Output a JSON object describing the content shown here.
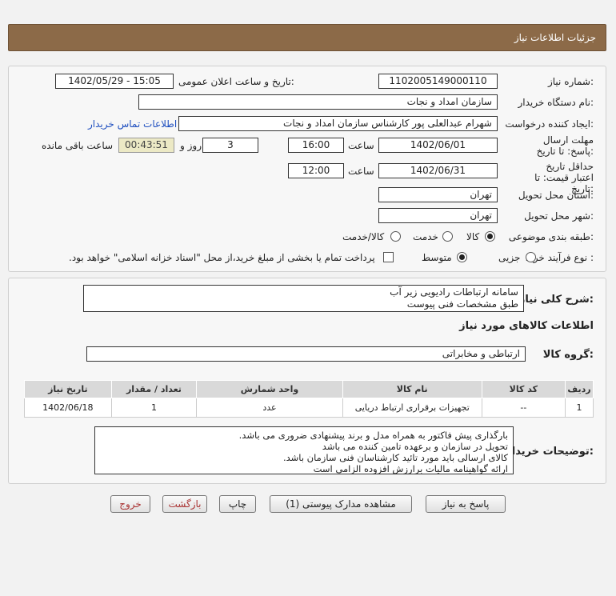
{
  "header": {
    "title": "جزئیات اطلاعات نیاز"
  },
  "form": {
    "need_number_label": "شماره نیاز:",
    "need_number": "1102005149000110",
    "announce_label": "تاریخ و ساعت اعلان عمومی:",
    "announce_value": "1402/05/29 - 15:05",
    "buyer_org_label": "نام دستگاه خریدار:",
    "buyer_org": "سازمان امداد و نجات",
    "requester_label": "ایجاد کننده درخواست:",
    "requester": "شهرام عبدالعلی پور کارشناس   سازمان امداد و نجات",
    "contact_link": "اطلاعات تماس خریدار",
    "deadline_label": "مهلت ارسال پاسخ: تا تاریخ:",
    "deadline_date": "1402/06/01",
    "time_label": "ساعت",
    "deadline_time": "16:00",
    "days_value": "3",
    "days_label": "روز و",
    "remaining_time": "00:43:51",
    "remaining_label": "ساعت باقی مانده",
    "validity_label": "حداقل تاریخ اعتبار قیمت: تا تاریخ:",
    "validity_date": "1402/06/31",
    "validity_time": "12:00",
    "province_label": "استان محل تحویل:",
    "province": "تهران",
    "city_label": "شهر محل تحویل:",
    "city": "تهران",
    "category_label": "طبقه بندی موضوعی:",
    "category_options": [
      "کالا",
      "خدمت",
      "کالا/خدمت"
    ],
    "category_selected": "کالا",
    "process_label": "نوع فرآیند خرید :",
    "process_options": [
      "جزیی",
      "متوسط"
    ],
    "process_selected": "متوسط",
    "payment_note": "پرداخت تمام یا بخشی از مبلغ خرید،از محل \"اسناد خزانه اسلامی\" خواهد بود."
  },
  "summary": {
    "label": "شرح کلی نیاز:",
    "line1": "سامانه ارتباطات رادیویی زیر آب",
    "line2": "طبق مشخصات فنی پیوست"
  },
  "goods": {
    "section_title": "اطلاعات کالاهای مورد نیاز",
    "group_label": "گروه کالا:",
    "group_value": "ارتباطی و مخابراتی",
    "columns": [
      "ردیف",
      "کد کالا",
      "نام کالا",
      "واحد شمارش",
      "تعداد / مقدار",
      "تاریخ نیاز"
    ],
    "rows": [
      {
        "row": "1",
        "code": "--",
        "name": "تجهیزات برقراری ارتباط دریایی",
        "unit": "عدد",
        "qty": "1",
        "date": "1402/06/18"
      }
    ]
  },
  "buyer_notes": {
    "label": "توضیحات خریدار:",
    "lines": [
      "بارگذاری پیش فاکتور به همراه مدل و برند پیشنهادی ضروری می باشد.",
      "تحویل در سازمان و برعهده تامین کننده می باشد",
      "کالای ارسالی باید مورد تائید کارشناسان فنی سازمان باشد.",
      "ارائه گواهینامه مالیات برارزش افزوده الزامی است"
    ]
  },
  "buttons": {
    "reply": "پاسخ به نیاز",
    "attachments": "مشاهده مدارک پیوستی (1)",
    "print": "چاپ",
    "back": "بازگشت",
    "exit": "خروج"
  },
  "colors": {
    "header_bg": "#8c6a48",
    "link": "#1f4fbf",
    "timer_bg": "#ece9c5"
  }
}
